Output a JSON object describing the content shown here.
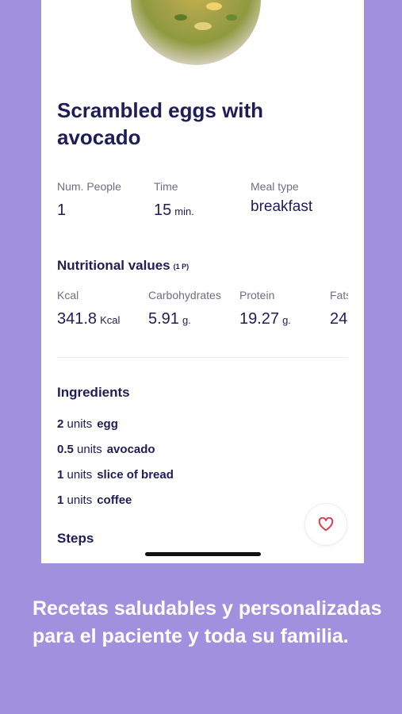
{
  "recipe": {
    "title": "Scrambled eggs with avocado",
    "info": [
      {
        "label": "Num. People",
        "value": "1",
        "unit": ""
      },
      {
        "label": "Time",
        "value": "15",
        "unit": "min."
      },
      {
        "label": "Meal type",
        "value": "breakfast",
        "unit": ""
      }
    ]
  },
  "nutrition": {
    "title": "Nutritional values",
    "portion": "(1 P)",
    "items": [
      {
        "label": "Kcal",
        "value": "341.8",
        "unit": "Kcal"
      },
      {
        "label": "Carbohydrates",
        "value": "5.91",
        "unit": "g."
      },
      {
        "label": "Protein",
        "value": "19.27",
        "unit": "g."
      },
      {
        "label": "Fats",
        "value": "24",
        "unit": ""
      }
    ]
  },
  "ingredients": {
    "title": "Ingredients",
    "items": [
      {
        "qty": "2",
        "unit": "units",
        "name": "egg"
      },
      {
        "qty": "0.5",
        "unit": "units",
        "name": "avocado"
      },
      {
        "qty": "1",
        "unit": "units",
        "name": "slice of bread"
      },
      {
        "qty": "1",
        "unit": "units",
        "name": "coffee"
      }
    ]
  },
  "steps": {
    "title": "Steps"
  },
  "favorite": {
    "icon": "heart-icon",
    "color": "#e0394a"
  },
  "caption": "Recetas saludables y personalizadas para el paciente y toda su familia.",
  "colors": {
    "background": "#a091df",
    "text_dark": "#1f1d57",
    "label": "#6c6f80"
  }
}
